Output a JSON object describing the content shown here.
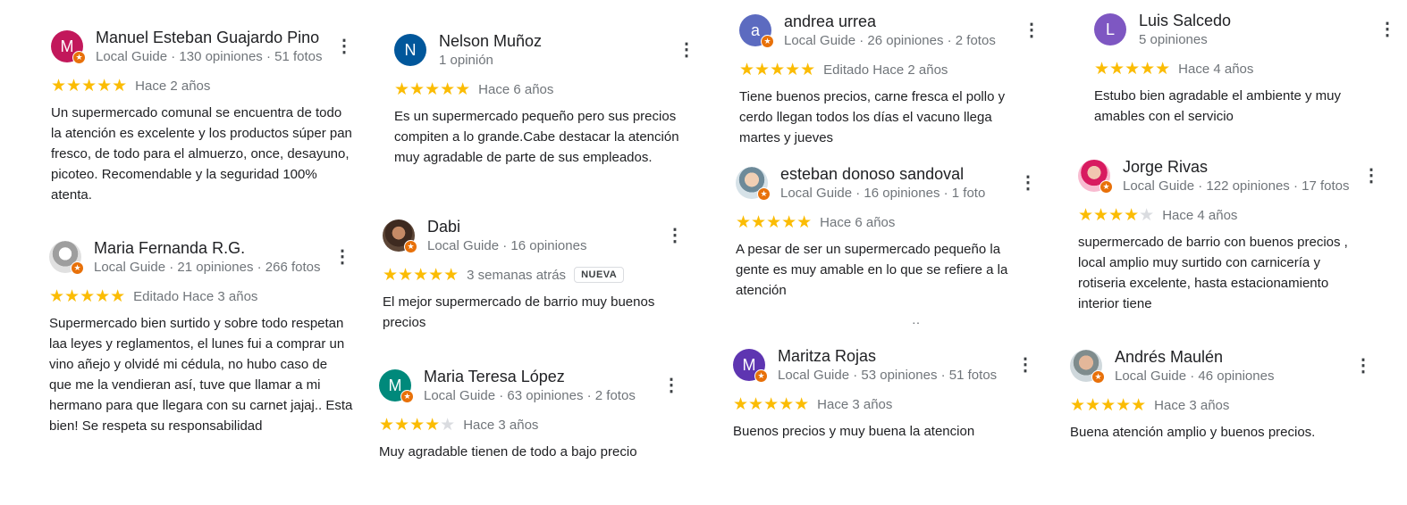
{
  "reviews": [
    {
      "name": "Manuel Esteban Guajardo Pino",
      "meta": "Local Guide · 130 opiniones · 51 fotos",
      "avatar_letter": "M",
      "avatar_color": "#c2185b",
      "local_guide": true,
      "stars": 5,
      "when": "Hace 2 años",
      "tag": "",
      "text": "Un supermercado comunal se encuentra de todo la atención es excelente y los productos súper pan fresco, de todo para el almuerzo, once, desayuno, picoteo. Recomendable y la seguridad 100% atenta."
    },
    {
      "name": "Maria Fernanda R.G.",
      "meta": "Local Guide · 21 opiniones · 266 fotos",
      "avatar_letter": "",
      "avatar_color": "",
      "local_guide": true,
      "stars": 5,
      "when": "Editado Hace 3 años",
      "tag": "",
      "text": "Supermercado bien surtido y sobre todo respetan laa leyes y reglamentos, el lunes fui a comprar un vino añejo y olvidé mi cédula, no hubo caso de que me la vendieran así, tuve que llamar a mi hermano para que llegara con su carnet jajaj.. Esta bien! Se respeta su responsabilidad"
    },
    {
      "name": "Nelson Muñoz",
      "meta": "1 opinión",
      "avatar_letter": "N",
      "avatar_color": "#01579b",
      "local_guide": false,
      "stars": 5,
      "when": "Hace 6 años",
      "tag": "",
      "text": "Es un supermercado pequeño pero sus precios compiten a lo grande.Cabe destacar la atención muy agradable de parte de sus empleados."
    },
    {
      "name": "Dabi",
      "meta": "Local Guide · 16 opiniones",
      "avatar_letter": "",
      "avatar_color": "",
      "local_guide": true,
      "stars": 5,
      "when": "3 semanas atrás",
      "tag": "NUEVA",
      "text": "El mejor supermercado de barrio muy buenos precios"
    },
    {
      "name": "Maria Teresa López",
      "meta": "Local Guide · 63 opiniones · 2 fotos",
      "avatar_letter": "M",
      "avatar_color": "#00897b",
      "local_guide": true,
      "stars": 4,
      "when": "Hace 3 años",
      "tag": "",
      "text": "Muy agradable tienen de todo a bajo precio"
    },
    {
      "name": "andrea urrea",
      "meta": "Local Guide · 26 opiniones · 2 fotos",
      "avatar_letter": "a",
      "avatar_color": "#5c6bc0",
      "local_guide": true,
      "stars": 5,
      "when": "Editado Hace 2 años",
      "tag": "",
      "text": "Tiene buenos precios, carne fresca el pollo y cerdo llegan todos los días el vacuno llega martes y jueves"
    },
    {
      "name": "esteban donoso sandoval",
      "meta": "Local Guide · 16 opiniones · 1 foto",
      "avatar_letter": "",
      "avatar_color": "",
      "local_guide": true,
      "stars": 5,
      "when": "Hace 6 años",
      "tag": "",
      "text": "A pesar de ser un supermercado pequeño la gente es muy amable en lo que se refiere a la atención"
    },
    {
      "name": "Maritza Rojas",
      "meta": "Local Guide · 53 opiniones · 51 fotos",
      "avatar_letter": "M",
      "avatar_color": "#5e35b1",
      "local_guide": true,
      "stars": 5,
      "when": "Hace 3 años",
      "tag": "",
      "text": "Buenos precios y muy buena la atencion"
    },
    {
      "name": "Luis Salcedo",
      "meta": "5 opiniones",
      "avatar_letter": "L",
      "avatar_color": "#7e57c2",
      "local_guide": false,
      "stars": 5,
      "when": "Hace 4 años",
      "tag": "",
      "text": "Estubo bien agradable el ambiente y muy amables con el servicio"
    },
    {
      "name": "Jorge Rivas",
      "meta": "Local Guide · 122 opiniones · 17 fotos",
      "avatar_letter": "",
      "avatar_color": "",
      "local_guide": true,
      "stars": 4,
      "when": "Hace 4 años",
      "tag": "",
      "text": "supermercado de barrio con buenos precios , local amplio muy surtido con carnicería y rotiseria excelente, hasta estacionamiento interior tiene"
    },
    {
      "name": "Andrés Maulén",
      "meta": "Local Guide · 46 opiniones",
      "avatar_letter": "",
      "avatar_color": "",
      "local_guide": true,
      "stars": 5,
      "when": "Hace 3 años",
      "tag": "",
      "text": "Buena atención amplio y buenos precios."
    }
  ],
  "ellipsis": "‥"
}
